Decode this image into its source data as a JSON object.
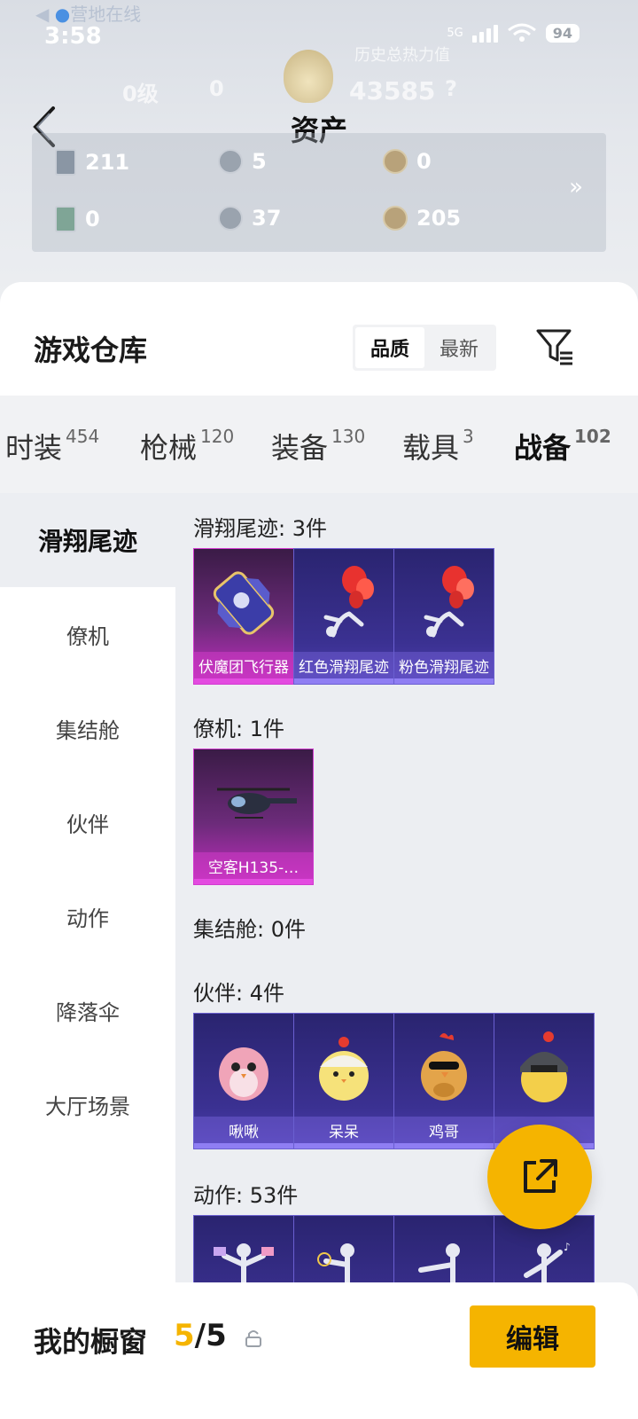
{
  "status": {
    "time": "3:58",
    "network": "5G",
    "battery": "94"
  },
  "ghost": {
    "top_link": "营地在线",
    "level": "0级",
    "level_value": "0",
    "heat_label": "历史总热力值",
    "heat_value": "43585",
    "heat_help": "?"
  },
  "header": {
    "title": "资产"
  },
  "assets": [
    {
      "icon": "card-icon",
      "value": "211"
    },
    {
      "icon": "silver-coin-icon",
      "value": "5"
    },
    {
      "icon": "gold-coin-icon",
      "value": "0"
    },
    {
      "icon": "green-card-icon",
      "value": "0"
    },
    {
      "icon": "silver-token-icon",
      "value": "37"
    },
    {
      "icon": "bronze-token-icon",
      "value": "205"
    }
  ],
  "warehouse": {
    "title": "游戏仓库",
    "sort_options": [
      "品质",
      "最新"
    ],
    "sort_active": "品质"
  },
  "tabs": [
    {
      "label": "时装",
      "count": "454"
    },
    {
      "label": "枪械",
      "count": "120"
    },
    {
      "label": "装备",
      "count": "130"
    },
    {
      "label": "载具",
      "count": "3"
    },
    {
      "label": "战备",
      "count": "102"
    }
  ],
  "active_tab": "战备",
  "categories": [
    "滑翔尾迹",
    "僚机",
    "集结舱",
    "伙伴",
    "动作",
    "降落伞",
    "大厅场景"
  ],
  "sections": [
    {
      "label": "滑翔尾迹: 3件",
      "items": [
        "伏魔团飞行器",
        "红色滑翔尾迹",
        "粉色滑翔尾迹"
      ]
    },
    {
      "label": "僚机: 1件",
      "items": [
        "空客H135-…"
      ]
    },
    {
      "label": "集结舱: 0件",
      "items": []
    },
    {
      "label": "伙伴: 4件",
      "items": [
        "啾啾",
        "呆呆",
        "鸡哥",
        ""
      ]
    },
    {
      "label": "动作: 53件",
      "items": [
        "",
        "",
        "",
        ""
      ]
    }
  ],
  "showcase": {
    "title": "我的橱窗",
    "current": "5",
    "total": "/5",
    "edit_label": "编辑"
  },
  "colors": {
    "accent": "#f5b400",
    "epic": "#d23ad0",
    "rare": "#6a5fd0"
  }
}
